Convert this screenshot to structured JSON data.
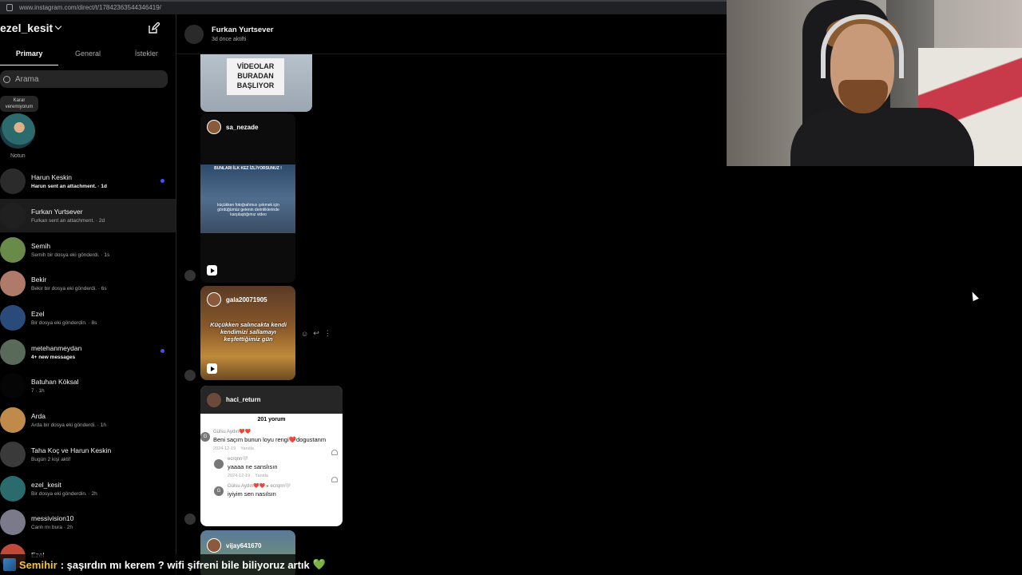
{
  "browser": {
    "url": "www.instagram.com/direct/t/17842363544346419/"
  },
  "sidebar": {
    "username": "ezel_kesit",
    "tabs": [
      "Primary",
      "General",
      "İstekler"
    ],
    "search_placeholder": "Arama",
    "note": {
      "text": "Karar veremiyorum",
      "label": "Notun"
    },
    "conversations": [
      {
        "name": "Harun Keskin",
        "sub": "Harun sent an attachment. · 1d",
        "unread": true,
        "color": "#2b2b2b"
      },
      {
        "name": "Furkan Yurtsever",
        "sub": "Furkan sent an attachment. · 2d",
        "unread": false,
        "selected": true,
        "color": "#202020"
      },
      {
        "name": "Semih",
        "sub": "Semih bir dosya eki gönderdi. · 1s",
        "unread": false,
        "color": "#6a8a4a"
      },
      {
        "name": "Bekir",
        "sub": "Bekir bir dosya eki gönderdi. · 6s",
        "unread": false,
        "color": "#b07a6a"
      },
      {
        "name": "Ezel",
        "sub": "Bir dosya eki gönderdin. · 8s",
        "unread": false,
        "color": "#2a4a7a"
      },
      {
        "name": "metehanmeydan",
        "sub": "4+ new messages",
        "unread": true,
        "color": "#5a6a5a"
      },
      {
        "name": "Batuhan Köksal",
        "sub": "7 · 1h",
        "unread": false,
        "color": "#050505"
      },
      {
        "name": "Arda",
        "sub": "Arda bir dosya eki gönderdi. · 1h",
        "unread": false,
        "color": "#c08a4a"
      },
      {
        "name": "Taha Koç ve Harun Keskin",
        "sub": "Bugün 2 kişi aktif",
        "unread": false,
        "color": "#3a3a3a"
      },
      {
        "name": "ezel_kesit",
        "sub": "Bir dosya eki gönderdin. · 2h",
        "unread": false,
        "color": "#2b6b6e"
      },
      {
        "name": "messivision10",
        "sub": "Canlı mı bura · 2h",
        "unread": false,
        "color": "#7a7a8a"
      },
      {
        "name": "Ezel",
        "sub": "",
        "unread": false,
        "color": "#c04a3a"
      }
    ]
  },
  "chat": {
    "contact_name": "Furkan Yurtsever",
    "status": "3d önce aktifti",
    "post1_sign": "VİDEOLAR BURADAN BAŞLIYOR",
    "reel1": {
      "owner": "sa_nezade",
      "cap_top": "BUNLARI İLK KEZ İZLİYORSUNUZ !",
      "cap_mid": "küçükken fotoğrafımızı çekmek için gördüğümüz gelenin derinliklerinde karşılaştığımız video"
    },
    "reel2": {
      "owner": "gala20071905",
      "caption": "Küçükken salıncakta kendi kendimizi sallamayı keşfettiğimiz gün"
    },
    "comments_post": {
      "owner": "haci_return",
      "count": "201 yorum",
      "comments": [
        {
          "avatar": "G",
          "user": "Gülsu Aydın❤️❤️",
          "text": "Beni saçım bunun loyu rengi❤️dogustanm",
          "date": "2024-12-19",
          "reply": "Yanıtla"
        },
        {
          "avatar": "",
          "user": "ecrqnn🤍",
          "text": "yaaaa ne sanslısın",
          "date": "2024-12-19",
          "reply": "Yanıtla"
        },
        {
          "avatar": "G",
          "user": "Gülsu Aydın❤️❤️ ▸ ecrqnn🤍",
          "text": "iyiyim sen nasılsın",
          "date": "",
          "reply": ""
        }
      ]
    },
    "reel3": {
      "owner": "vijay641670"
    }
  },
  "stream_overlay": {
    "user": "Semihir",
    "message": ": şaşırdın mı kerem ? wifi şifreni bile biliyoruz artık",
    "emoji": "💚"
  }
}
